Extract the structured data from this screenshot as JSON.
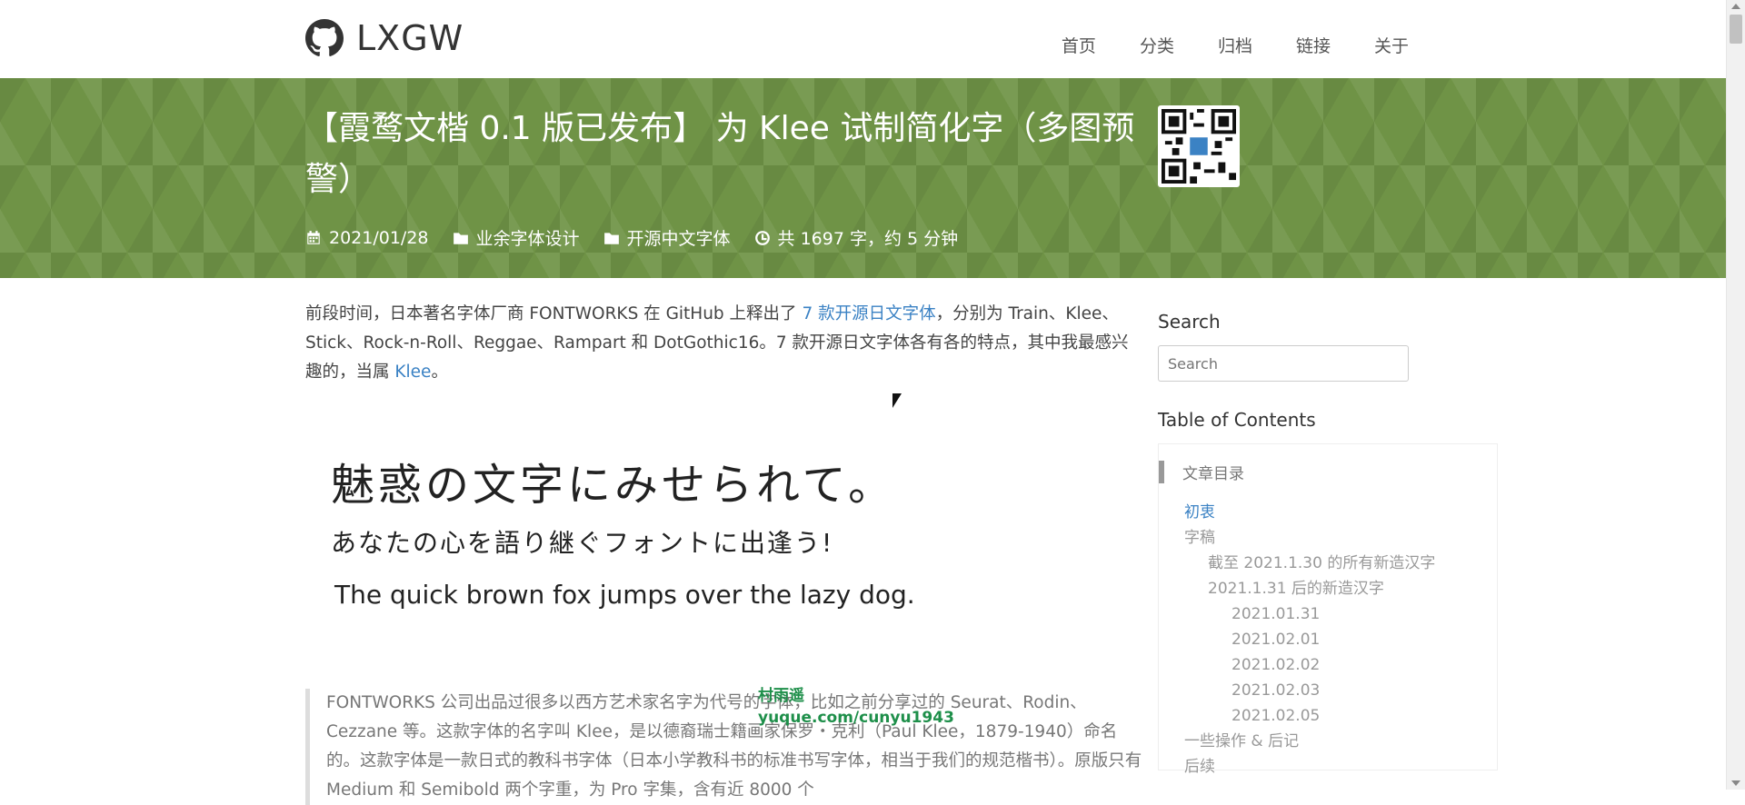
{
  "site": {
    "name": "LXGW"
  },
  "nav": [
    "首页",
    "分类",
    "归档",
    "链接",
    "关于"
  ],
  "post": {
    "title": "【霞鹜文楷 0.1 版已发布】 为 Klee 试制简化字（多图预警）",
    "date": "2021/01/28",
    "category1": "业余字体设计",
    "category2": "开源中文字体",
    "stats": "共 1697 字，约 5 分钟"
  },
  "article": {
    "p1_before": "前段时间，日本著名字体厂商 FONTWORKS 在 GitHub 上释出了 ",
    "p1_link": "7 款开源日文字体",
    "p1_middle": "，分别为 Train、Klee、Stick、Rock-n-Roll、Reggae、Rampart 和 DotGothic16。7 款开源日文字体各有各的特点，其中我最感兴趣的，当属 ",
    "p1_link2": "Klee",
    "p1_after": "。",
    "sample_line1": "魅惑の文字にみせられて。",
    "sample_line2": "あなたの心を語り継ぐフォントに出逢う!",
    "sample_line3": "The quick brown fox jumps over the lazy dog.",
    "quote": "FONTWORKS 公司出品过很多以西方艺术家名字为代号的字体，比如之前分享过的 Seurat、Rodin、Cezzane 等。这款字体的名字叫 Klee，是以德裔瑞士籍画家保罗・克利（Paul Klee，1879-1940）命名的。这款字体是一款日式的教科书字体（日本小学教科书的标准书写字体，相当于我们的规范楷书）。原版只有 Medium 和 Semibold 两个字重，为 Pro 字集，含有近 8000 个",
    "watermark_line1": "村雨遥",
    "watermark_line2": "yuque.com/cunyu1943"
  },
  "sidebar": {
    "search_title": "Search",
    "search_placeholder": "Search",
    "toc_title": "Table of Contents",
    "toc_head": "文章目录",
    "toc": [
      {
        "label": "初衷",
        "level": 1,
        "active": true
      },
      {
        "label": "字稿",
        "level": 1,
        "active": false
      },
      {
        "label": "截至 2021.1.30 的所有新造汉字",
        "level": 2,
        "active": false
      },
      {
        "label": "2021.1.31 后的新造汉字",
        "level": 2,
        "active": false
      },
      {
        "label": "2021.01.31",
        "level": 3,
        "active": false
      },
      {
        "label": "2021.02.01",
        "level": 3,
        "active": false
      },
      {
        "label": "2021.02.02",
        "level": 3,
        "active": false
      },
      {
        "label": "2021.02.03",
        "level": 3,
        "active": false
      },
      {
        "label": "2021.02.05",
        "level": 3,
        "active": false
      },
      {
        "label": "一些操作 & 后记",
        "level": 1,
        "active": false
      },
      {
        "label": "后续",
        "level": 1,
        "active": false
      }
    ]
  },
  "colors": {
    "hero": "#6f9346",
    "link": "#3b82c4"
  }
}
